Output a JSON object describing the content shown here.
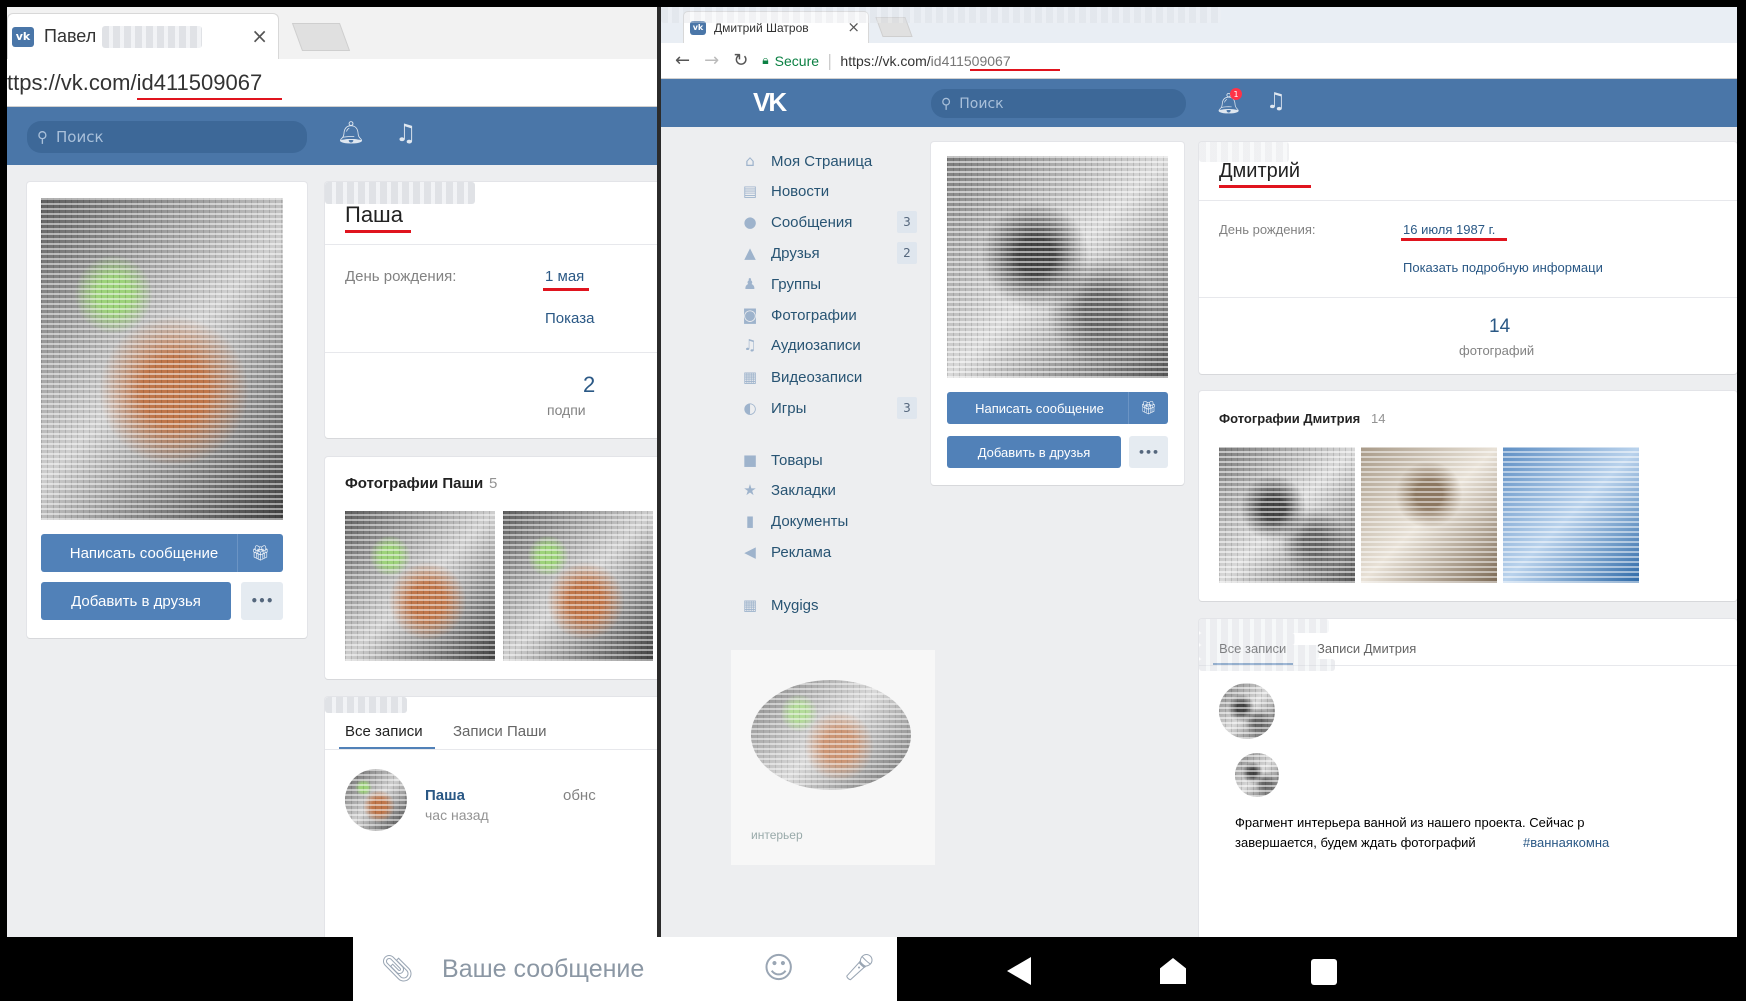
{
  "left_window": {
    "tab_title": "Павел",
    "tab_favicon": "vk-icon",
    "tab_close": "×",
    "address": "ttps://vk.com/id411509067",
    "search_placeholder": "Поиск",
    "profile": {
      "name": "Паша",
      "birthday_label": "День рождения:",
      "birthday_value": "1 мая",
      "show_more": "Показа",
      "counter_value": "2",
      "counter_label": "подпи",
      "write_message": "Написать сообщение",
      "add_friend": "Добавить в друзья",
      "more": "•••",
      "photos_title": "Фотографии Паши",
      "photos_count": "5",
      "tabs": [
        "Все записи",
        "Записи Паши"
      ],
      "post_author": "Паша",
      "post_action": "обнс",
      "post_time": "час назад"
    }
  },
  "right_window": {
    "tab_title": "Дмитрий Шатров",
    "tab_close": "×",
    "secure_label": "Secure",
    "url_prefix": "https://vk.com/",
    "url_id": "id411509067",
    "search_placeholder": "Поиск",
    "notification_count": "1",
    "menu": [
      {
        "label": "Моя Страница",
        "icon": "home-icon",
        "glyph": "⌂",
        "badge": ""
      },
      {
        "label": "Новости",
        "icon": "news-icon",
        "glyph": "▤",
        "badge": ""
      },
      {
        "label": "Сообщения",
        "icon": "messages-icon",
        "glyph": "●",
        "badge": "3"
      },
      {
        "label": "Друзья",
        "icon": "friends-icon",
        "glyph": "▲",
        "badge": "2"
      },
      {
        "label": "Группы",
        "icon": "groups-icon",
        "glyph": "♟",
        "badge": ""
      },
      {
        "label": "Фотографии",
        "icon": "camera-icon",
        "glyph": "◙",
        "badge": ""
      },
      {
        "label": "Аудиозаписи",
        "icon": "music-icon",
        "glyph": "♫",
        "badge": ""
      },
      {
        "label": "Видеозаписи",
        "icon": "video-icon",
        "glyph": "▦",
        "badge": ""
      },
      {
        "label": "Игры",
        "icon": "gamepad-icon",
        "glyph": "◐",
        "badge": "3"
      },
      {
        "label": "Товары",
        "icon": "bag-icon",
        "glyph": "■",
        "badge": ""
      },
      {
        "label": "Закладки",
        "icon": "star-icon",
        "glyph": "★",
        "badge": ""
      },
      {
        "label": "Документы",
        "icon": "document-icon",
        "glyph": "▮",
        "badge": ""
      },
      {
        "label": "Реклама",
        "icon": "megaphone-icon",
        "glyph": "◀",
        "badge": ""
      },
      {
        "label": "Mygigs",
        "icon": "apps-icon",
        "glyph": "▦",
        "badge": ""
      }
    ],
    "profile": {
      "name": "Дмитрий",
      "birthday_label": "День рождения:",
      "birthday_value": "16 июля 1987 г.",
      "show_more": "Показать подробную информаци",
      "photos_count_value": "14",
      "photos_count_label": "фотографий",
      "write_message": "Написать сообщение",
      "add_friend": "Добавить в друзья",
      "more": "•••",
      "photos_title": "Фотографии Дмитрия",
      "photos_count": "14",
      "tabs": [
        "Все записи",
        "Записи Дмитрия"
      ],
      "post_text_1": "Фрагмент интерьера ванной из нашего проекта. Сейчас р",
      "post_text_2": "завершается, будем ждать фотографий",
      "post_hashtag": "#ваннаякомна",
      "ad_caption": "интерьер"
    }
  },
  "composer": {
    "placeholder": "Ваше сообщение"
  },
  "colors": {
    "vk_blue": "#4a76a8",
    "button_blue": "#5181b8",
    "link": "#2a5885",
    "underline_red": "#e0141e"
  }
}
